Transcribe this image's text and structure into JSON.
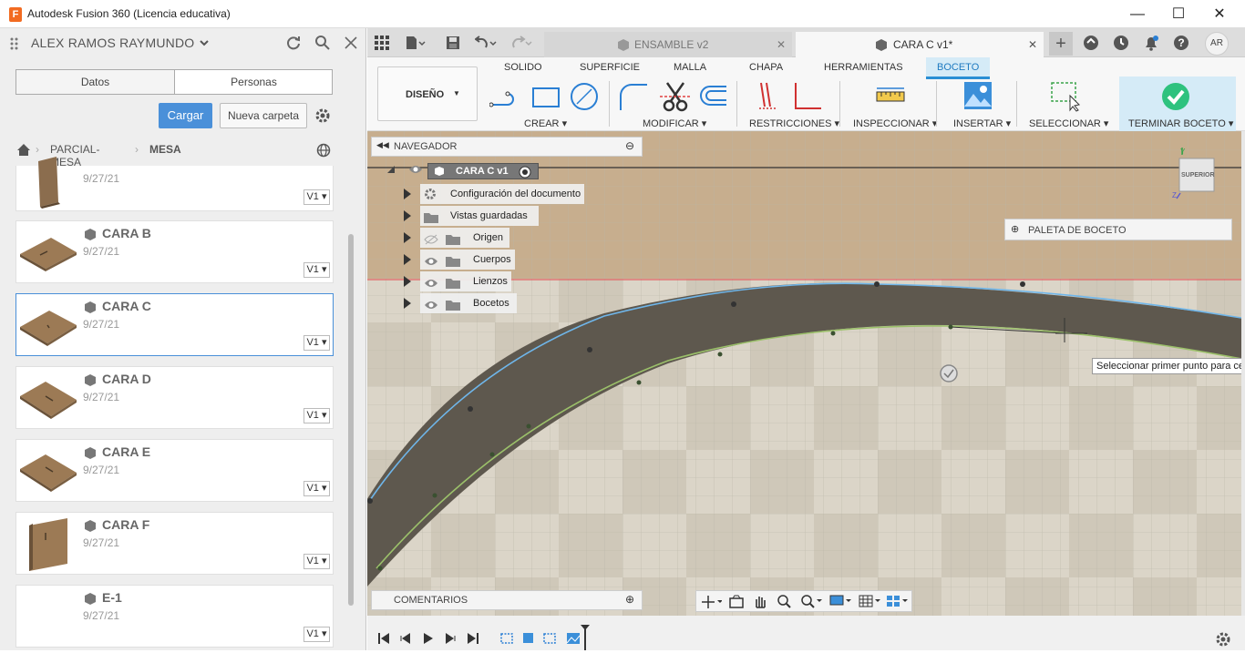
{
  "window": {
    "title": "Autodesk Fusion 360 (Licencia educativa)",
    "logo_letter": "F",
    "controls": [
      "—",
      "☐",
      "✕"
    ]
  },
  "left_panel": {
    "user_name": "ALEX RAMOS RAYMUNDO",
    "tabs": [
      "Datos",
      "Personas"
    ],
    "upload_label": "Cargar",
    "new_folder_label": "Nueva carpeta",
    "breadcrumb": [
      "PARCIAL-MESA",
      "MESA"
    ],
    "items": [
      {
        "name": "",
        "date": "9/27/21",
        "version": "V1"
      },
      {
        "name": "CARA B",
        "date": "9/27/21",
        "version": "V1"
      },
      {
        "name": "CARA C",
        "date": "9/27/21",
        "version": "V1",
        "selected": true
      },
      {
        "name": "CARA D",
        "date": "9/27/21",
        "version": "V1"
      },
      {
        "name": "CARA E",
        "date": "9/27/21",
        "version": "V1"
      },
      {
        "name": "CARA F",
        "date": "9/27/21",
        "version": "V1"
      },
      {
        "name": "E-1",
        "date": "9/27/21",
        "version": "V1"
      }
    ]
  },
  "doc_tabs": [
    {
      "label": "ENSAMBLE v2",
      "active": false
    },
    {
      "label": "CARA C v1*",
      "active": true
    }
  ],
  "user_initials": "AR",
  "ribbon": {
    "workspace": "DISEÑO",
    "tabs": [
      "SOLIDO",
      "SUPERFICIE",
      "MALLA",
      "CHAPA",
      "HERRAMIENTAS",
      "BOCETO"
    ],
    "active_tab": "BOCETO",
    "groups": [
      "CREAR",
      "MODIFICAR",
      "RESTRICCIONES",
      "INSPECCIONAR",
      "INSERTAR",
      "SELECCIONAR",
      "TERMINAR BOCETO"
    ]
  },
  "browser": {
    "header": "NAVEGADOR",
    "root": "CARA C v1",
    "items": [
      "Configuración del documento",
      "Vistas guardadas",
      "Origen",
      "Cuerpos",
      "Lienzos",
      "Bocetos"
    ]
  },
  "sketch_palette": "PALETA DE BOCETO",
  "viewcube_label": "SUPERIOR",
  "tooltip": "Seleccionar primer punto para cerr",
  "comments_label": "COMENTARIOS",
  "colors": {
    "accent": "#4a90d9",
    "finish_green": "#2ec27e",
    "active_tab_bg": "#d5ebf7"
  }
}
